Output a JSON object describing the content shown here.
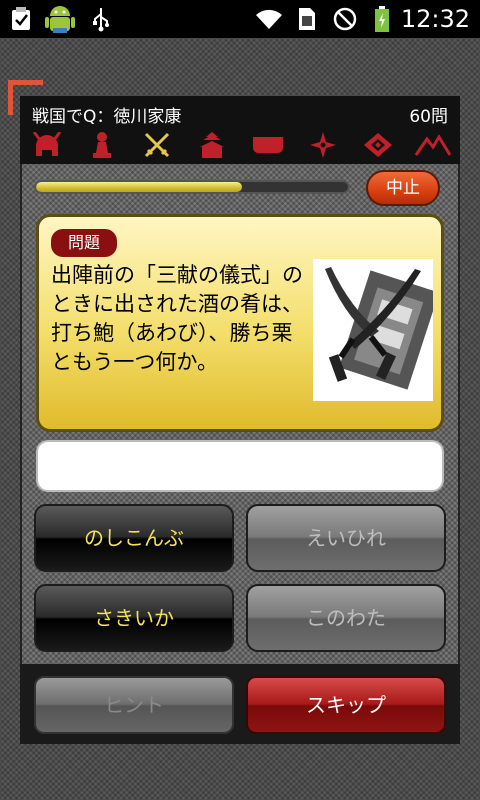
{
  "status_bar": {
    "time": "12:32",
    "icons": [
      "clipboard-check-icon",
      "android-robot-icon",
      "usb-icon",
      "wifi-icon",
      "sim-icon",
      "no-signal-icon",
      "battery-charging-icon"
    ]
  },
  "header": {
    "title": "戦国でQ：徳川家康",
    "count": "60問",
    "category_icons": [
      "helmet-icon",
      "chess-piece-icon",
      "crossed-swords-icon",
      "castle-icon",
      "flag-icon",
      "shuriken-icon",
      "diamond-crest-icon",
      "mountains-icon"
    ],
    "icon_color": "#c0202a"
  },
  "progress": {
    "fraction": 0.66,
    "color": "#d8c53a"
  },
  "stop_button": {
    "label": "中止"
  },
  "question": {
    "badge": "問題",
    "text": "出陣前の「三献の儀式」のときに出された酒の肴は、打ち鮑（あわび）、勝ち栗ともう一つ何か。",
    "image_icon": "katana-illustration-icon"
  },
  "answer_field": {
    "value": ""
  },
  "choices": [
    {
      "label": "のしこんぶ",
      "state": "active"
    },
    {
      "label": "えいひれ",
      "state": "disabled"
    },
    {
      "label": "さきいか",
      "state": "active"
    },
    {
      "label": "このわた",
      "state": "disabled"
    }
  ],
  "bottom": {
    "hint_label": "ヒント",
    "skip_label": "スキップ"
  }
}
